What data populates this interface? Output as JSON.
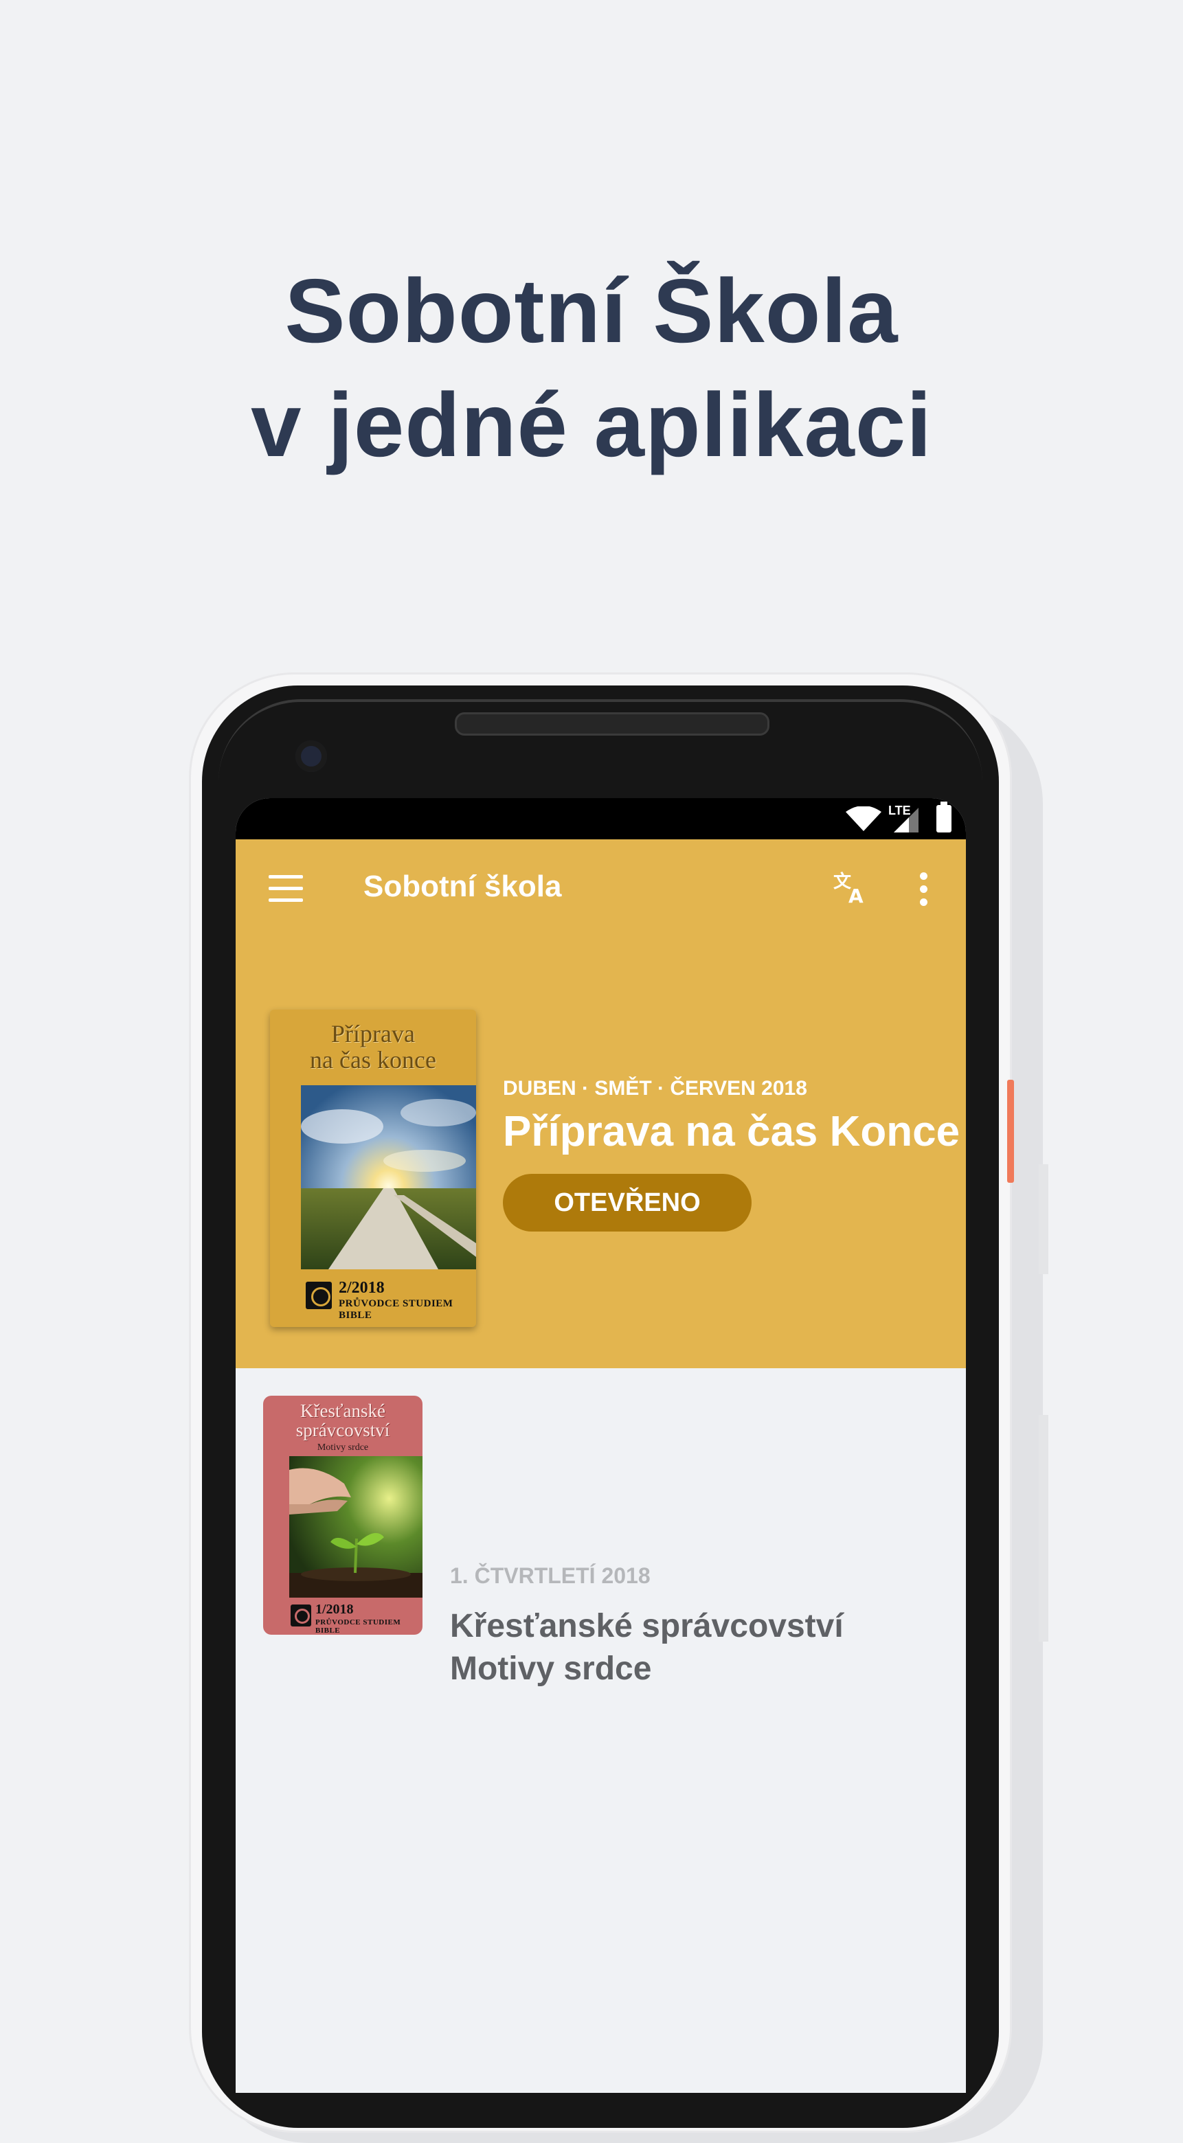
{
  "headline": {
    "line1": "Sobotní Škola",
    "line2": "v jedné aplikaci"
  },
  "status_bar": {
    "network": "LTE"
  },
  "app_bar": {
    "title": "Sobotní škola",
    "menu_icon": "hamburger-menu-icon",
    "translate_icon": "translate-icon",
    "more_icon": "more-vert-icon"
  },
  "featured": {
    "dates": "DUBEN · SMĚT · ČERVEN 2018",
    "title": "Příprava na čas Konce",
    "button": "OTEVŘENO",
    "cover": {
      "title_line1": "Příprava",
      "title_line2": "na čas konce",
      "issue": "2/2018",
      "subtitle": "PRŮVODCE STUDIEM BIBLE"
    }
  },
  "quarterlies": [
    {
      "date": "1. ČTVRTLETÍ 2018",
      "title_line1": "Křesťanské správcovství",
      "title_line2": "Motivy srdce",
      "cover": {
        "title_line1": "Křesťanské",
        "title_line2": "správcovství",
        "subtitle_small": "Motivy srdce",
        "issue": "1/2018",
        "subtitle": "PRŮVODCE STUDIEM BIBLE"
      }
    }
  ],
  "colors": {
    "background": "#f1f2f4",
    "headline": "#2e3a52",
    "accent": "#e3b54f",
    "button": "#ae7a0b"
  }
}
